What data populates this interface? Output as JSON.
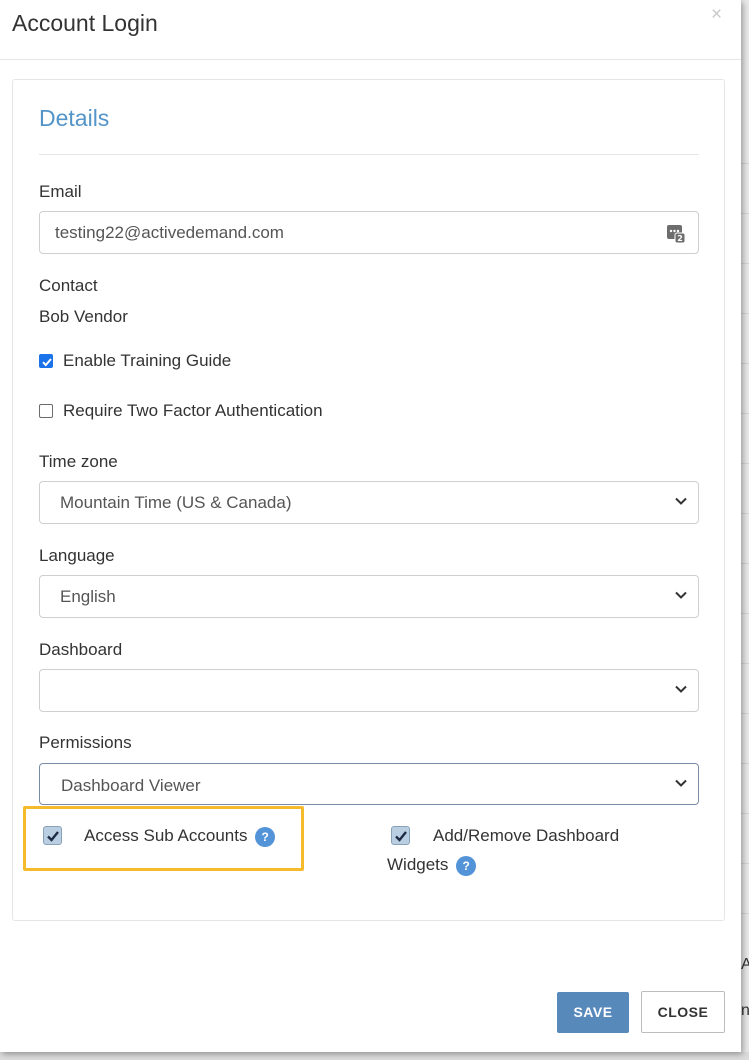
{
  "modal": {
    "title": "Account Login",
    "close_icon": "×"
  },
  "details": {
    "section_title": "Details",
    "email_label": "Email",
    "email_value": "testing22@activedemand.com",
    "contact_label": "Contact",
    "contact_value": "Bob Vendor",
    "enable_training_label": "Enable Training Guide",
    "enable_training_checked": true,
    "two_factor_label": "Require Two Factor Authentication",
    "two_factor_checked": false,
    "timezone_label": "Time zone",
    "timezone_value": "Mountain Time (US & Canada)",
    "language_label": "Language",
    "language_value": "English",
    "dashboard_label": "Dashboard",
    "dashboard_value": "",
    "permissions_label": "Permissions",
    "permissions_value": "Dashboard Viewer"
  },
  "permissions": {
    "access_sub_accounts_label": "Access Sub Accounts",
    "access_sub_accounts_checked": true,
    "add_remove_widgets_label_1": "Add/Remove Dashboard",
    "add_remove_widgets_label_2": "Widgets",
    "add_remove_widgets_checked": true,
    "help_glyph": "?"
  },
  "footer": {
    "save_label": "SAVE",
    "close_label": "CLOSE"
  },
  "background_edge": {
    "glyph_a": "A",
    "glyph_n": "n"
  },
  "colors": {
    "accent_blue": "#5394c9",
    "save_button": "#5889bb",
    "highlight": "#f6bb2c",
    "checkbox_checked": "#1a73e8"
  }
}
